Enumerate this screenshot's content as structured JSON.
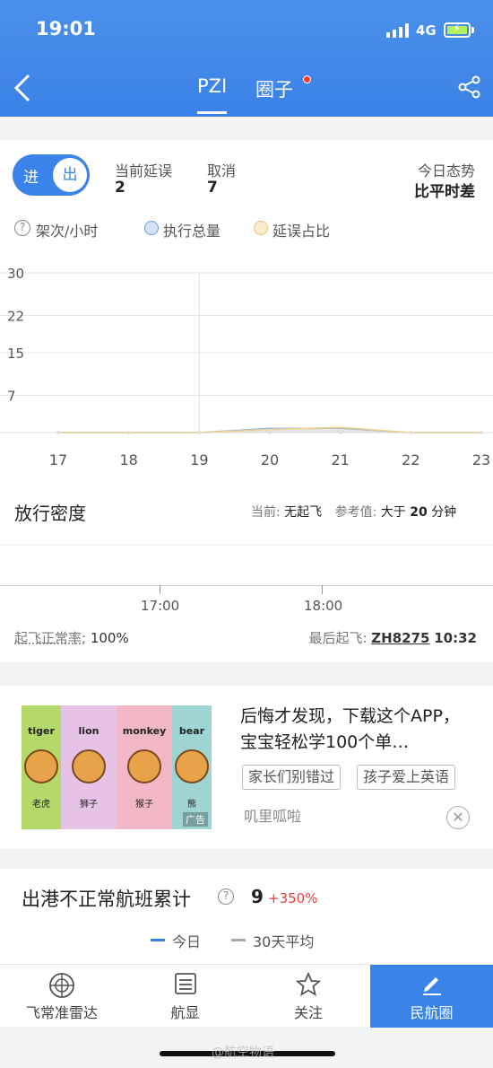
{
  "status_bar": {
    "time": "19:01",
    "network": "4G"
  },
  "header": {
    "tabs": [
      {
        "label": "PZI",
        "active": true
      },
      {
        "label": "圈子",
        "active": false,
        "has_dot": true
      }
    ]
  },
  "summary": {
    "toggle_in": "进",
    "toggle_out": "出",
    "delay_label": "当前延误",
    "delay_value": "2",
    "cancel_label": "取消",
    "cancel_value": "7",
    "trend_label": "今日态势",
    "trend_value": "比平时差"
  },
  "legend": {
    "unit": "架次/小时",
    "total": "执行总量",
    "delay_ratio": "延误占比",
    "colors": {
      "total": "#8fb4ec",
      "delay_ratio": "#f3d08e"
    }
  },
  "chart_data": {
    "type": "area",
    "x": [
      17,
      18,
      19,
      20,
      21,
      22,
      23
    ],
    "y_ticks": [
      30,
      22,
      15,
      7
    ],
    "ylim": [
      0,
      30
    ],
    "series": [
      {
        "values": [
          0,
          0,
          0,
          0.8,
          0.8,
          0,
          0
        ],
        "color": "#8fb4ec"
      },
      {
        "values": [
          0,
          0,
          0,
          0.6,
          1.0,
          0,
          0
        ],
        "color": "#f3d08e"
      }
    ],
    "current_marker_x": 19
  },
  "release": {
    "title": "放行密度",
    "current_label": "当前:",
    "current_value": "无起飞",
    "ref_label": "参考值:",
    "ref_value_prefix": "大于",
    "ref_value_num": "20",
    "ref_value_unit": "分钟"
  },
  "timeline": {
    "ticks": [
      "17:00",
      "18:00"
    ],
    "ontime_label": "起飞正常率:",
    "ontime_value": "100%",
    "last_label": "最后起飞:",
    "last_flight": "ZH8275",
    "last_time": "10:32"
  },
  "ad": {
    "animals": [
      {
        "en": "tiger",
        "cn": "老虎",
        "bg": "#b5d86b"
      },
      {
        "en": "lion",
        "cn": "狮子",
        "bg": "#e6c2e6"
      },
      {
        "en": "monkey",
        "cn": "猴子",
        "bg": "#f3b8c8"
      },
      {
        "en": "bear",
        "cn": "熊",
        "bg": "#9ed4d1"
      }
    ],
    "ad_mark": "广告",
    "title": "后悔才发现，下载这个APP，宝宝轻松学100个单…",
    "tags": [
      "家长们别错过",
      "孩子爱上英语"
    ],
    "source": "叽里呱啦"
  },
  "abnormal": {
    "title": "出港不正常航班累计",
    "count": "9",
    "change": "+350%",
    "legend_today": "今日",
    "legend_avg": "30天平均"
  },
  "tabbar": {
    "items": [
      {
        "label": "飞常准雷达",
        "icon": "radar-icon"
      },
      {
        "label": "航显",
        "icon": "board-icon"
      },
      {
        "label": "关注",
        "icon": "star-icon"
      },
      {
        "label": "民航圈",
        "icon": "pen-icon",
        "active": true
      }
    ]
  },
  "watermark": "@航空物语"
}
